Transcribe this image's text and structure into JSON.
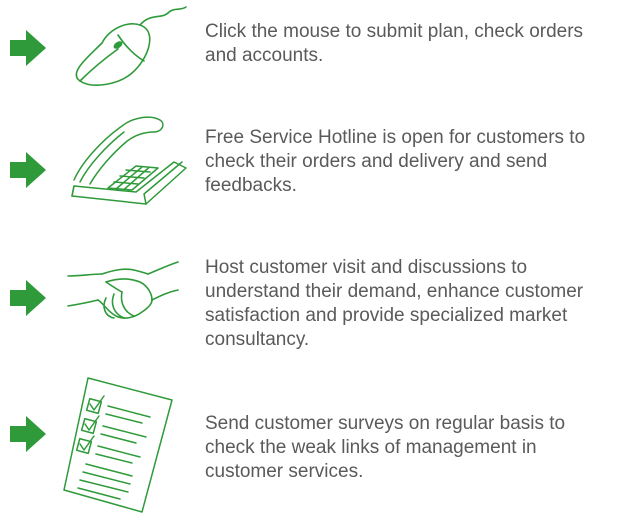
{
  "items": [
    {
      "icon": "mouse-icon",
      "text": "Click the mouse to submit plan, check orders and accounts."
    },
    {
      "icon": "telephone-icon",
      "text": "Free Service Hotline is open for customers to check their orders and delivery and send feedbacks."
    },
    {
      "icon": "handshake-icon",
      "text": "Host customer visit and discussions to understand their demand, enhance customer satisfaction and provide specialized market consultancy."
    },
    {
      "icon": "checklist-icon",
      "text": "Send customer surveys on regular basis to check the weak links of management in customer services."
    }
  ],
  "colors": {
    "accent": "#2f9a3a",
    "text": "#5a5a5a"
  }
}
